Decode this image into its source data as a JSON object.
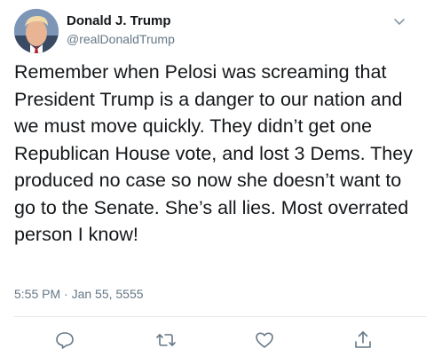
{
  "tweet": {
    "author": {
      "display_name": "Donald J. Trump",
      "handle": "@realDonaldTrump"
    },
    "text": "Remember when Pelosi was screaming that President Trump is a danger to our nation and we must move quickly. They didn’t get one Republican House vote, and lost 3 Dems. They produced no case so now she doesn’t want to go to the Senate. She’s all lies. Most overrated person I know!",
    "timestamp": "5:55 PM · Jan 55, 5555"
  },
  "icons": {
    "menu": "chevron-down-icon",
    "reply": "reply-icon",
    "retweet": "retweet-icon",
    "like": "heart-icon",
    "share": "share-icon"
  },
  "colors": {
    "text_primary": "#14171a",
    "text_secondary": "#657786",
    "divider": "#e6ecf0"
  }
}
